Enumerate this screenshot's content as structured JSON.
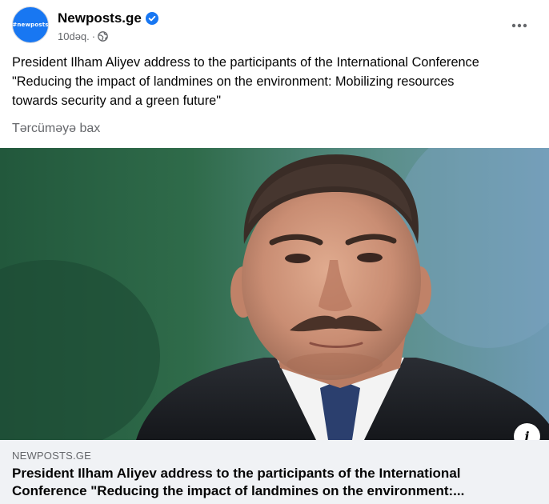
{
  "post": {
    "page_name": "Newposts.ge",
    "avatar_text": "#newposts",
    "time": "10dəq.",
    "meta_separator": "·",
    "text_lines": [
      "President Ilham Aliyev address to the participants of the International Conference",
      "\"Reducing the impact of landmines on the environment: Mobilizing resources",
      "towards security and a green future\""
    ],
    "see_translation": "Tərcüməyə bax"
  },
  "link_preview": {
    "domain": "NEWPOSTS.GE",
    "title_lines": [
      "President Ilham Aliyev address to the participants of the International",
      "Conference \"Reducing the impact of landmines on the environment:..."
    ],
    "info_label": "i"
  },
  "colors": {
    "brand_blue": "#1877f2",
    "secondary_text": "#65676b",
    "preview_bg": "#f0f2f5"
  },
  "icons": {
    "verified": "verified-badge-icon",
    "audience": "globe-icon",
    "more": "more-options-icon",
    "info": "info-icon"
  }
}
